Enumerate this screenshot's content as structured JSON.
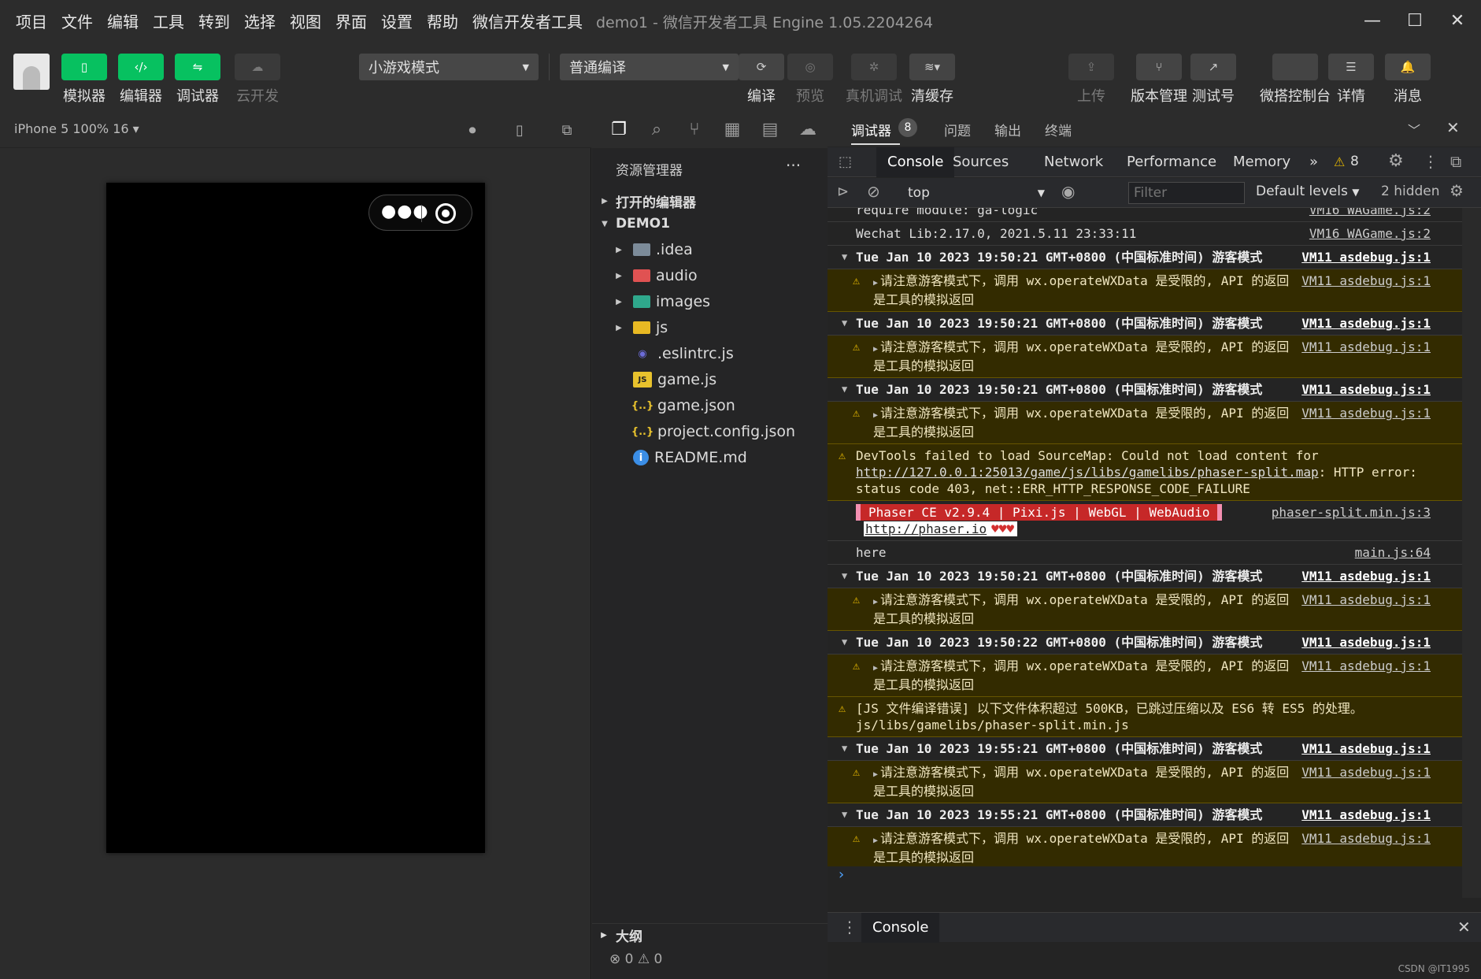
{
  "menu": [
    "项目",
    "文件",
    "编辑",
    "工具",
    "转到",
    "选择",
    "视图",
    "界面",
    "设置",
    "帮助",
    "微信开发者工具"
  ],
  "window_title": "demo1 - 微信开发者工具 Engine 1.05.2204264",
  "toolbar": {
    "left": [
      {
        "label": "模拟器",
        "icon": "phone-icon"
      },
      {
        "label": "编辑器",
        "icon": "code-icon"
      },
      {
        "label": "调试器",
        "icon": "debug-icon"
      },
      {
        "label": "云开发",
        "icon": "cloud-icon"
      }
    ],
    "mode_select": "小游戏模式",
    "compile_select": "普通编译",
    "mid": [
      {
        "label": "编译",
        "icon": "refresh-icon"
      },
      {
        "label": "预览",
        "icon": "eye-icon"
      },
      {
        "label": "真机调试",
        "icon": "bug-icon"
      },
      {
        "label": "清缓存",
        "icon": "layers-icon"
      }
    ],
    "right": [
      {
        "label": "上传",
        "icon": "upload-icon"
      },
      {
        "label": "版本管理",
        "icon": "branch-icon"
      },
      {
        "label": "测试号",
        "icon": "external-link-icon"
      },
      {
        "label": "微搭控制台",
        "icon": "blank-icon"
      },
      {
        "label": "详情",
        "icon": "menu-icon"
      },
      {
        "label": "消息",
        "icon": "bell-icon"
      }
    ]
  },
  "simulator": {
    "device_info": "iPhone 5 100% 16 ▾"
  },
  "explorer": {
    "title": "资源管理器",
    "more": "···",
    "open_editors": "打开的编辑器",
    "project": "DEMO1",
    "items": [
      {
        "name": ".idea",
        "type": "folder",
        "color": "#7c8b99"
      },
      {
        "name": "audio",
        "type": "folder",
        "color": "#e05252"
      },
      {
        "name": "images",
        "type": "folder",
        "color": "#2fa88c"
      },
      {
        "name": "js",
        "type": "folder",
        "color": "#e8b923"
      },
      {
        "name": ".eslintrc.js",
        "type": "file",
        "icon": "◉",
        "color": "#6c6cd8"
      },
      {
        "name": "game.js",
        "type": "file",
        "icon": "JS",
        "color": "#e8c22d"
      },
      {
        "name": "game.json",
        "type": "file",
        "icon": "{..}",
        "color": "#e8c22d"
      },
      {
        "name": "project.config.json",
        "type": "file",
        "icon": "{..}",
        "color": "#e8c22d"
      },
      {
        "name": "README.md",
        "type": "file",
        "icon": "i",
        "color": "#3b8ee6"
      }
    ],
    "outline": "大纲",
    "status": "⊗ 0 ⚠ 0"
  },
  "devtools": {
    "tabs": [
      "调试器",
      "问题",
      "输出",
      "终端"
    ],
    "badge": "8",
    "chrome_tabs": [
      "Console",
      "Sources",
      "Network",
      "Performance",
      "Memory"
    ],
    "more_tabs": "»",
    "warn_count": "8",
    "context": "top",
    "filter_placeholder": "Filter",
    "levels": "Default levels",
    "hidden": "2 hidden",
    "drawer_tab": "Console",
    "prompt": "›"
  },
  "console_lines": [
    {
      "type": "log",
      "text": "require module: ga-logic",
      "src": "VM16 WAGame.js:2"
    },
    {
      "type": "log",
      "text": "Wechat Lib:2.17.0, 2021.5.11 23:33:11",
      "src": "VM16 WAGame.js:2"
    },
    {
      "type": "group",
      "text": "Tue Jan 10 2023 19:50:21 GMT+0800 (中国标准时间) 游客模式",
      "src": "VM11 asdebug.js:1"
    },
    {
      "type": "warn-child",
      "text": "请注意游客模式下，调用 wx.operateWXData 是受限的, API 的返回是工具的模拟返回",
      "src": "VM11 asdebug.js:1"
    },
    {
      "type": "group",
      "text": "Tue Jan 10 2023 19:50:21 GMT+0800 (中国标准时间) 游客模式",
      "src": "VM11 asdebug.js:1"
    },
    {
      "type": "warn-child",
      "text": "请注意游客模式下，调用 wx.operateWXData 是受限的, API 的返回是工具的模拟返回",
      "src": "VM11 asdebug.js:1"
    },
    {
      "type": "group",
      "text": "Tue Jan 10 2023 19:50:21 GMT+0800 (中国标准时间) 游客模式",
      "src": "VM11 asdebug.js:1"
    },
    {
      "type": "warn-child",
      "text": "请注意游客模式下，调用 wx.operateWXData 是受限的, API 的返回是工具的模拟返回",
      "src": "VM11 asdebug.js:1"
    },
    {
      "type": "warn-sourcemap",
      "text_a": "DevTools failed to load SourceMap: Could not load content for ",
      "link": "http://127.0.0.1:25013/game/js/libs/gamelibs/phaser-split.map",
      "text_b": ": HTTP error: status code 403, net::ERR_HTTP_RESPONSE_CODE_FAILURE"
    },
    {
      "type": "phaser",
      "banner": "Phaser CE v2.9.4 | Pixi.js | WebGL | WebAudio",
      "link": "http://phaser.io",
      "hearts": "♥♥♥",
      "src": "phaser-split.min.js:3"
    },
    {
      "type": "log",
      "text": "here",
      "src": "main.js:64"
    },
    {
      "type": "group",
      "text": "Tue Jan 10 2023 19:50:21 GMT+0800 (中国标准时间) 游客模式",
      "src": "VM11 asdebug.js:1"
    },
    {
      "type": "warn-child",
      "text": "请注意游客模式下，调用 wx.operateWXData 是受限的, API 的返回是工具的模拟返回",
      "src": "VM11 asdebug.js:1"
    },
    {
      "type": "group",
      "text": "Tue Jan 10 2023 19:50:22 GMT+0800 (中国标准时间) 游客模式",
      "src": "VM11 asdebug.js:1"
    },
    {
      "type": "warn-child",
      "text": "请注意游客模式下，调用 wx.operateWXData 是受限的, API 的返回是工具的模拟返回",
      "src": "VM11 asdebug.js:1"
    },
    {
      "type": "warn",
      "text": "[JS 文件编译错误] 以下文件体积超过 500KB，已跳过压缩以及 ES6 转 ES5 的处理。 js/libs/gamelibs/phaser-split.min.js",
      "src": ""
    },
    {
      "type": "group",
      "text": "Tue Jan 10 2023 19:55:21 GMT+0800 (中国标准时间) 游客模式",
      "src": "VM11 asdebug.js:1"
    },
    {
      "type": "warn-child",
      "text": "请注意游客模式下，调用 wx.operateWXData 是受限的, API 的返回是工具的模拟返回",
      "src": "VM11 asdebug.js:1"
    },
    {
      "type": "group",
      "text": "Tue Jan 10 2023 19:55:21 GMT+0800 (中国标准时间) 游客模式",
      "src": "VM11 asdebug.js:1"
    },
    {
      "type": "warn-child",
      "text": "请注意游客模式下，调用 wx.operateWXData 是受限的, API 的返回是工具的模拟返回",
      "src": "VM11 asdebug.js:1"
    }
  ],
  "watermark": "CSDN @IT1995",
  "colors": {
    "accent_green": "#07c160",
    "warn_bg": "#332b00",
    "phaser_red": "#c62828"
  }
}
